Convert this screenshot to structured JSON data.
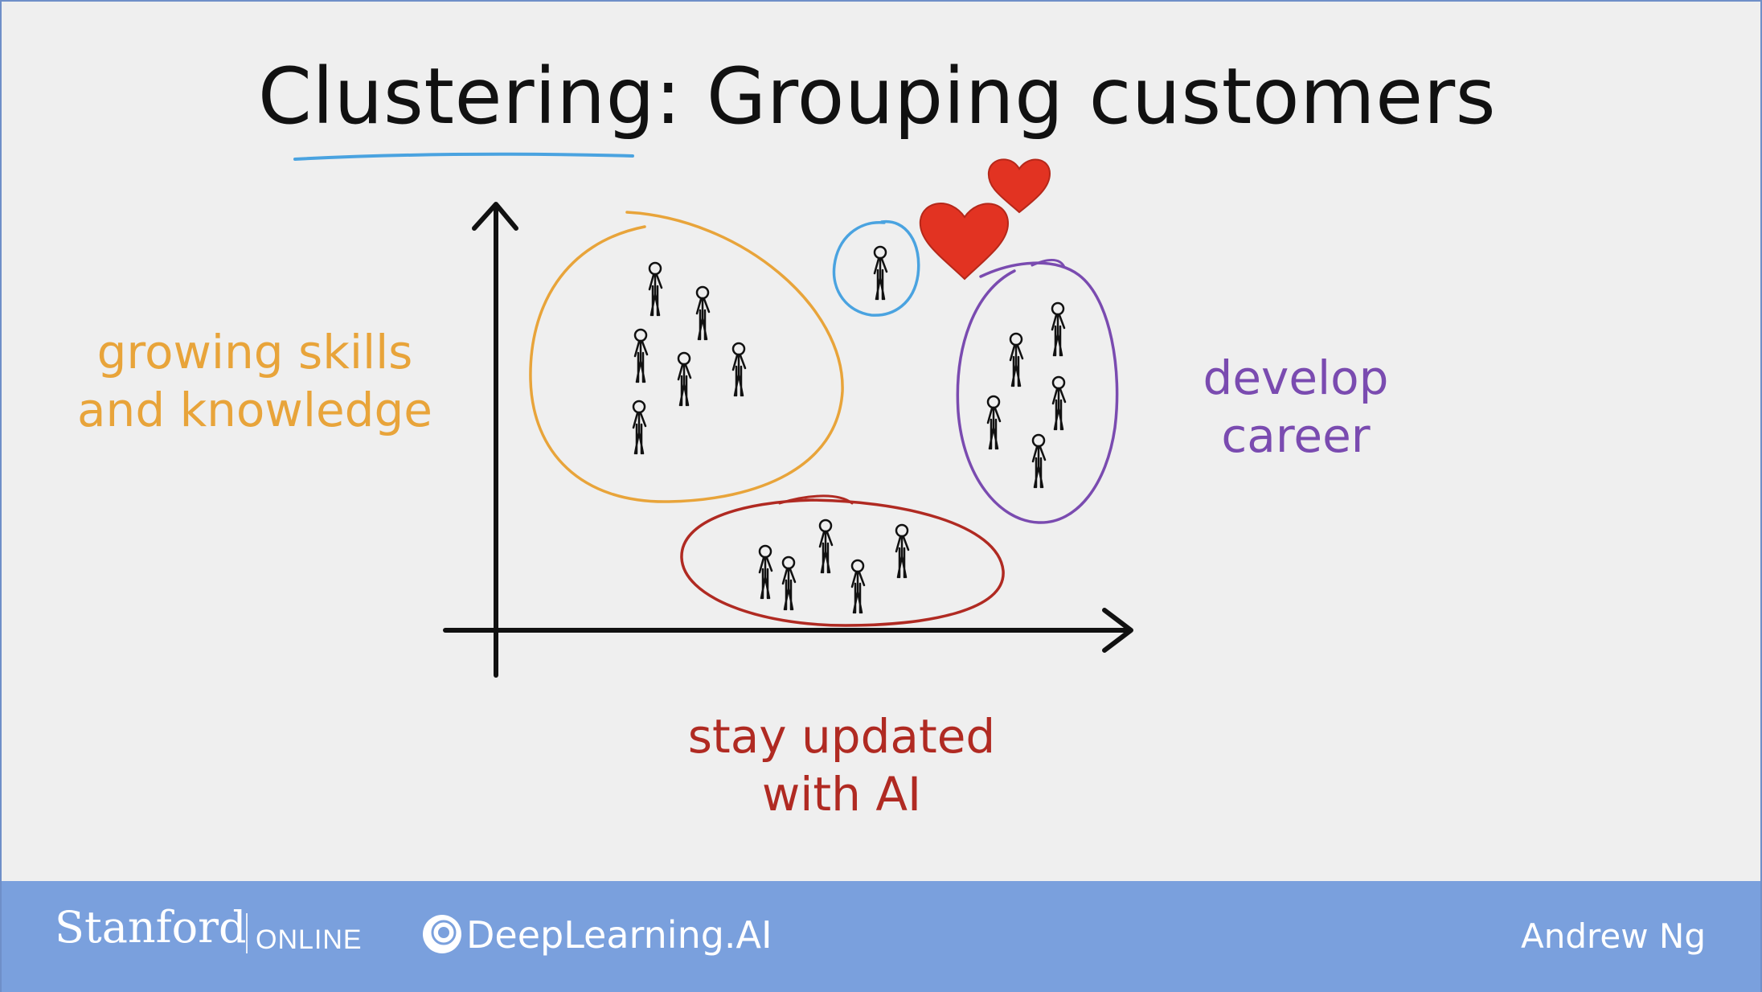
{
  "slide": {
    "title": "Clustering: Grouping customers"
  },
  "clusters": [
    {
      "label": "growing skills\nand knowledge",
      "color": "#e8a43a"
    },
    {
      "label": "develop\ncareer",
      "color": "#7a4bb0"
    },
    {
      "label": "stay updated\nwith AI",
      "color": "#b02a22"
    },
    {
      "label": "",
      "color": "#4aa3e0"
    }
  ],
  "footer": {
    "stanford": "Stanford",
    "online": "ONLINE",
    "deeplearning": "DeepLearning.AI",
    "instructor": "Andrew Ng"
  },
  "icons": [
    "heart-icon",
    "person-icon",
    "deeplearning-logo-icon"
  ]
}
